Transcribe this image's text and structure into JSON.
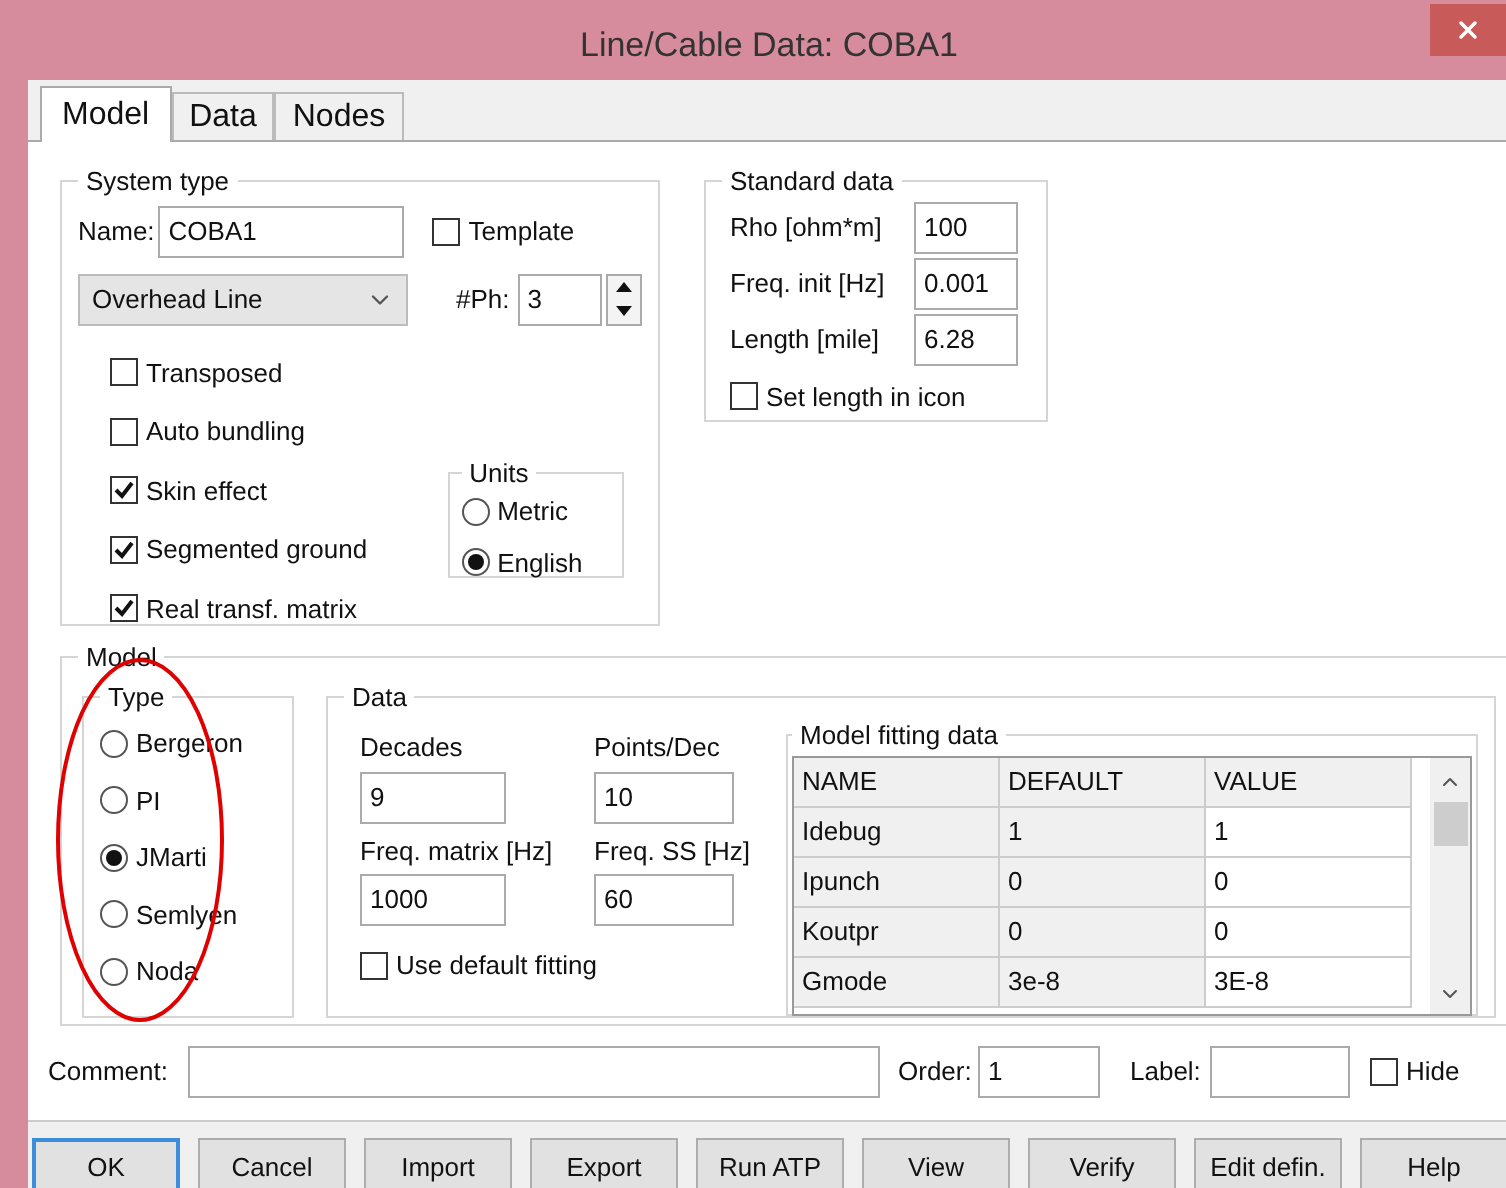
{
  "window": {
    "title": "Line/Cable Data: COBA1"
  },
  "tabs": [
    {
      "label": "Model",
      "selected": true
    },
    {
      "label": "Data",
      "selected": false
    },
    {
      "label": "Nodes",
      "selected": false
    }
  ],
  "system_type": {
    "title": "System type",
    "name_label": "Name:",
    "name_value": "COBA1",
    "template": {
      "label": "Template",
      "checked": false
    },
    "line_type": "Overhead Line",
    "phases_label": "#Ph:",
    "phases_value": "3",
    "options": [
      {
        "label": "Transposed",
        "checked": false
      },
      {
        "label": "Auto bundling",
        "checked": false
      },
      {
        "label": "Skin effect",
        "checked": true
      },
      {
        "label": "Segmented ground",
        "checked": true
      },
      {
        "label": "Real transf. matrix",
        "checked": true
      }
    ],
    "units": {
      "title": "Units",
      "options": [
        {
          "label": "Metric",
          "selected": false
        },
        {
          "label": "English",
          "selected": true
        }
      ]
    }
  },
  "standard_data": {
    "title": "Standard data",
    "fields": [
      {
        "label": "Rho [ohm*m]",
        "value": "100"
      },
      {
        "label": "Freq. init [Hz]",
        "value": "0.001"
      },
      {
        "label": "Length [mile]",
        "value": "6.28"
      }
    ],
    "set_length": {
      "label": "Set length in icon",
      "checked": false
    }
  },
  "model": {
    "title": "Model",
    "type": {
      "title": "Type",
      "options": [
        {
          "label": "Bergeron",
          "selected": false
        },
        {
          "label": "PI",
          "selected": false
        },
        {
          "label": "JMarti",
          "selected": true
        },
        {
          "label": "Semlyen",
          "selected": false
        },
        {
          "label": "Noda",
          "selected": false
        }
      ]
    },
    "data": {
      "title": "Data",
      "fields": [
        {
          "label": "Decades",
          "value": "9"
        },
        {
          "label": "Points/Dec",
          "value": "10"
        },
        {
          "label": "Freq. matrix [Hz]",
          "value": "1000"
        },
        {
          "label": "Freq. SS [Hz]",
          "value": "60"
        }
      ],
      "use_default": {
        "label": "Use default fitting",
        "checked": false
      },
      "fitting": {
        "title": "Model fitting data",
        "columns": [
          "NAME",
          "DEFAULT",
          "VALUE"
        ],
        "rows": [
          [
            "Idebug",
            "1",
            "1"
          ],
          [
            "Ipunch",
            "0",
            "0"
          ],
          [
            "Koutpr",
            "0",
            "0"
          ],
          [
            "Gmode",
            "3e-8",
            "3E-8"
          ]
        ]
      }
    }
  },
  "footer": {
    "comment_label": "Comment:",
    "order_label": "Order:",
    "order_value": "1",
    "label_label": "Label:",
    "hide": {
      "label": "Hide",
      "checked": false
    }
  },
  "buttons": [
    {
      "label": "OK",
      "focused": true
    },
    {
      "label": "Cancel",
      "focused": false
    },
    {
      "label": "Import",
      "focused": false
    },
    {
      "label": "Export",
      "focused": false
    },
    {
      "label": "Run ATP",
      "focused": false
    },
    {
      "label": "View",
      "focused": false
    },
    {
      "label": "Verify",
      "focused": false
    },
    {
      "label": "Edit defin.",
      "focused": false
    },
    {
      "label": "Help",
      "focused": false
    }
  ]
}
